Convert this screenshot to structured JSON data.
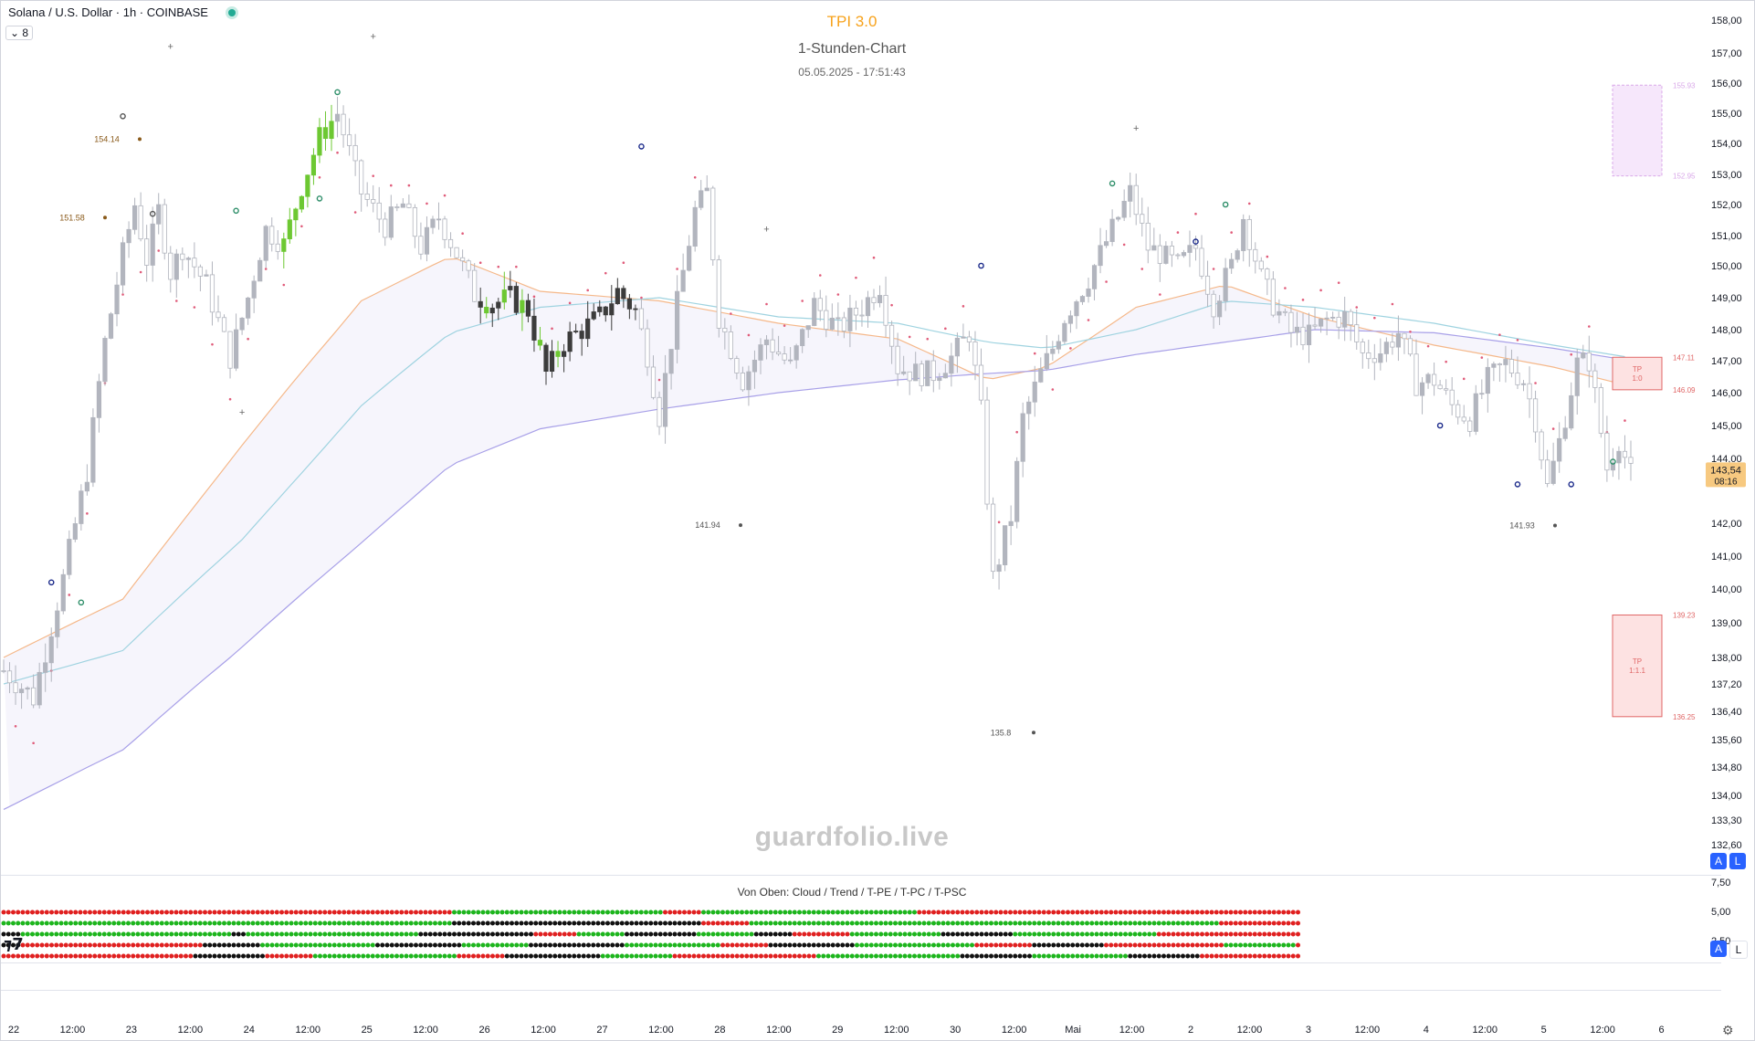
{
  "header": {
    "symbol": "Solana / U.S. Dollar · 1h · COINBASE",
    "collapse_count": "8",
    "title": "TPI 3.0",
    "subtitle": "1-Stunden-Chart",
    "timestamp": "05.05.2025 - 17:51:43"
  },
  "watermark": "guardfolio.live",
  "indicator_label": "Von Oben: Cloud / Trend / T-PE / T-PC / T-PSC",
  "colors": {
    "up": "#6dc832",
    "down_dark": "#3c3c3c",
    "neutral": "#b2b5be",
    "red_dot": "#e02020",
    "green_dot": "#1db51d",
    "black_dot": "#111111",
    "trend_dots": "#e05c7a",
    "ema_orange": "#f5b88a",
    "ema_teal": "#9fd3e0",
    "ema_purple": "#a8a0e8",
    "tp_red": "#e06666",
    "tp_pink": "#d9a8e8",
    "price_badge": "#f7c980"
  },
  "axis_badges": {
    "a": "A",
    "l": "L"
  },
  "icons": [
    "tradingview-logo-icon",
    "settings-gear-icon",
    "chevron-down-icon",
    "live-status-icon"
  ],
  "chart_data": [
    {
      "type": "candlestick",
      "title": "TPI 3.0",
      "subtitle": "1-Stunden-Chart",
      "ylim": [
        132.6,
        158.0
      ],
      "y_ticks": [
        "158,00",
        "157,00",
        "156,00",
        "155,00",
        "154,00",
        "153,00",
        "152,00",
        "151,00",
        "150,00",
        "149,00",
        "148,00",
        "147,00",
        "146,00",
        "145,00",
        "144,00",
        "142,00",
        "141,00",
        "140,00",
        "139,00",
        "138,00",
        "137,20",
        "136,40",
        "135,60",
        "134,80",
        "134,00",
        "133,30",
        "132,60"
      ],
      "y_tick_values": [
        158,
        157,
        156,
        155,
        154,
        153,
        152,
        151,
        150,
        149,
        148,
        147,
        146,
        145,
        144,
        142,
        141,
        140,
        139,
        138,
        137.2,
        136.4,
        135.6,
        134.8,
        134,
        133.3,
        132.6
      ],
      "x_ticks": [
        "22",
        "12:00",
        "23",
        "12:00",
        "24",
        "12:00",
        "25",
        "12:00",
        "26",
        "12:00",
        "27",
        "12:00",
        "28",
        "12:00",
        "29",
        "12:00",
        "30",
        "12:00",
        "Mai",
        "12:00",
        "2",
        "12:00",
        "3",
        "12:00",
        "4",
        "12:00",
        "5",
        "12:00",
        "6"
      ],
      "last_price": "143,54",
      "countdown": "08:16",
      "level_labels": [
        {
          "text": "154.14",
          "value": 154.14
        },
        {
          "text": "151.58",
          "value": 151.58
        },
        {
          "text": "141.94",
          "value": 141.94
        },
        {
          "text": "141.93",
          "value": 141.93
        },
        {
          "text": "135.8",
          "value": 135.8
        }
      ],
      "targets": [
        {
          "label": "TP",
          "sublabel": "1:0",
          "top": 147.11,
          "bottom": 146.09,
          "top_text": "147.11",
          "bottom_text": "146.09",
          "color": "red"
        },
        {
          "label": "TP",
          "sublabel": "1:1.1",
          "top": 139.23,
          "bottom": 136.25,
          "top_text": "139.23",
          "bottom_text": "136.25",
          "color": "red"
        },
        {
          "label": "",
          "sublabel": "",
          "top": 155.93,
          "bottom": 152.95,
          "top_text": "155.93",
          "bottom_text": "152.95",
          "color": "pink"
        }
      ],
      "price_path": [
        [
          0,
          137.6
        ],
        [
          5,
          136.8
        ],
        [
          10,
          140.3
        ],
        [
          14,
          143.6
        ],
        [
          17,
          147.6
        ],
        [
          20,
          150.4
        ],
        [
          22,
          152.0
        ],
        [
          24,
          150.2
        ],
        [
          26,
          151.8
        ],
        [
          28,
          149.8
        ],
        [
          30,
          150.6
        ],
        [
          34,
          149.4
        ],
        [
          38,
          147.1
        ],
        [
          41,
          149.0
        ],
        [
          44,
          151.2
        ],
        [
          47,
          150.7
        ],
        [
          50,
          152.6
        ],
        [
          53,
          154.2
        ],
        [
          56,
          155.0
        ],
        [
          60,
          152.4
        ],
        [
          64,
          151.3
        ],
        [
          67,
          152.0
        ],
        [
          70,
          150.6
        ],
        [
          73,
          151.6
        ],
        [
          76,
          150.4
        ],
        [
          79,
          149.1
        ],
        [
          82,
          148.8
        ],
        [
          85,
          149.0
        ],
        [
          88,
          148.6
        ],
        [
          91,
          146.6
        ],
        [
          94,
          147.6
        ],
        [
          97,
          148.0
        ],
        [
          100,
          148.4
        ],
        [
          103,
          149.2
        ],
        [
          106,
          148.6
        ],
        [
          108,
          147.2
        ],
        [
          110,
          145.3
        ],
        [
          113,
          148.8
        ],
        [
          116,
          151.8
        ],
        [
          118,
          152.4
        ],
        [
          120,
          148.4
        ],
        [
          124,
          146.4
        ],
        [
          128,
          147.7
        ],
        [
          132,
          146.8
        ],
        [
          136,
          148.8
        ],
        [
          140,
          148.0
        ],
        [
          144,
          148.7
        ],
        [
          147,
          149.4
        ],
        [
          150,
          146.8
        ],
        [
          153,
          146.6
        ],
        [
          156,
          146.6
        ],
        [
          159,
          147.1
        ],
        [
          162,
          147.9
        ],
        [
          164,
          145.4
        ],
        [
          166,
          140.3
        ],
        [
          169,
          142.2
        ],
        [
          171,
          145.2
        ],
        [
          174,
          146.6
        ],
        [
          176,
          147.4
        ],
        [
          178,
          148.4
        ],
        [
          182,
          149.6
        ],
        [
          186,
          151.2
        ],
        [
          189,
          152.4
        ],
        [
          192,
          150.6
        ],
        [
          194,
          150.4
        ],
        [
          197,
          150.0
        ],
        [
          200,
          150.6
        ],
        [
          203,
          148.8
        ],
        [
          206,
          150.0
        ],
        [
          208,
          151.6
        ],
        [
          211,
          149.6
        ],
        [
          213,
          148.8
        ],
        [
          216,
          147.9
        ],
        [
          219,
          147.8
        ],
        [
          222,
          148.3
        ],
        [
          225,
          148.4
        ],
        [
          228,
          147.2
        ],
        [
          231,
          147.3
        ],
        [
          234,
          147.9
        ],
        [
          237,
          146.3
        ],
        [
          240,
          146.4
        ],
        [
          243,
          145.6
        ],
        [
          246,
          145.2
        ],
        [
          249,
          146.4
        ],
        [
          252,
          146.9
        ],
        [
          255,
          146.4
        ],
        [
          257,
          145.2
        ],
        [
          259,
          143.1
        ],
        [
          261,
          144.5
        ],
        [
          264,
          146.9
        ],
        [
          266,
          147.0
        ],
        [
          269,
          143.7
        ],
        [
          271,
          144.6
        ],
        [
          273,
          143.5
        ]
      ],
      "series": [
        {
          "name": "",
          "color": "orange",
          "points": [
            [
              0,
              138.0
            ],
            [
              20,
              139.7
            ],
            [
              40,
              144.4
            ],
            [
              60,
              148.9
            ],
            [
              75,
              150.3
            ],
            [
              90,
              149.2
            ],
            [
              110,
              148.9
            ],
            [
              130,
              148.2
            ],
            [
              150,
              147.7
            ],
            [
              165,
              146.4
            ],
            [
              175,
              146.8
            ],
            [
              190,
              148.7
            ],
            [
              205,
              149.4
            ],
            [
              220,
              148.4
            ],
            [
              240,
              147.5
            ],
            [
              260,
              146.8
            ],
            [
              273,
              146.2
            ]
          ]
        },
        {
          "name": "",
          "color": "teal",
          "points": [
            [
              0,
              137.2
            ],
            [
              20,
              138.2
            ],
            [
              40,
              141.5
            ],
            [
              60,
              145.6
            ],
            [
              75,
              147.9
            ],
            [
              90,
              148.7
            ],
            [
              110,
              149.0
            ],
            [
              130,
              148.4
            ],
            [
              150,
              148.2
            ],
            [
              165,
              147.6
            ],
            [
              175,
              147.4
            ],
            [
              190,
              148.0
            ],
            [
              205,
              148.9
            ],
            [
              220,
              148.7
            ],
            [
              240,
              148.2
            ],
            [
              260,
              147.5
            ],
            [
              273,
              147.1
            ]
          ]
        },
        {
          "name": "",
          "color": "purple",
          "points": [
            [
              0,
              133.6
            ],
            [
              20,
              135.3
            ],
            [
              40,
              138.3
            ],
            [
              60,
              141.4
            ],
            [
              75,
              143.8
            ],
            [
              90,
              144.9
            ],
            [
              110,
              145.5
            ],
            [
              130,
              146.0
            ],
            [
              150,
              146.4
            ],
            [
              165,
              146.6
            ],
            [
              175,
              146.7
            ],
            [
              190,
              147.2
            ],
            [
              205,
              147.6
            ],
            [
              220,
              148.0
            ],
            [
              240,
              147.9
            ],
            [
              260,
              147.4
            ],
            [
              273,
              147.0
            ]
          ]
        }
      ]
    },
    {
      "type": "dot-matrix",
      "title": "Von Oben: Cloud / Trend / T-PE / T-PC / T-PSC",
      "y_ticks": [
        "7,50",
        "5,00",
        "2,50"
      ],
      "rows": [
        {
          "name": "Cloud",
          "segments": [
            [
              "red",
              94
            ],
            [
              "green",
              44
            ],
            [
              "red",
              8
            ],
            [
              "green",
              45
            ],
            [
              "red",
              80
            ]
          ]
        },
        {
          "name": "Trend",
          "segments": [
            [
              "green",
              94
            ],
            [
              "black",
              52
            ],
            [
              "red",
              10
            ],
            [
              "green",
              98
            ],
            [
              "red",
              17
            ]
          ]
        },
        {
          "name": "T-PE",
          "segments": [
            [
              "black",
              4
            ],
            [
              "green",
              44
            ],
            [
              "black",
              3
            ],
            [
              "green",
              36
            ],
            [
              "black",
              24
            ],
            [
              "red",
              9
            ],
            [
              "green",
              10
            ],
            [
              "black",
              15
            ],
            [
              "green",
              12
            ],
            [
              "black",
              8
            ],
            [
              "red",
              12
            ],
            [
              "green",
              19
            ],
            [
              "black",
              15
            ],
            [
              "green",
              30
            ],
            [
              "red",
              30
            ]
          ]
        },
        {
          "name": "T-PC",
          "segments": [
            [
              "black",
              4
            ],
            [
              "red",
              38
            ],
            [
              "black",
              12
            ],
            [
              "green",
              24
            ],
            [
              "black",
              18
            ],
            [
              "green",
              14
            ],
            [
              "black",
              20
            ],
            [
              "green",
              20
            ],
            [
              "red",
              10
            ],
            [
              "black",
              18
            ],
            [
              "green",
              25
            ],
            [
              "red",
              12
            ],
            [
              "black",
              15
            ],
            [
              "red",
              25
            ],
            [
              "green",
              15
            ]
          ]
        },
        {
          "name": "T-PSC",
          "segments": [
            [
              "red",
              40
            ],
            [
              "black",
              15
            ],
            [
              "red",
              10
            ],
            [
              "green",
              30
            ],
            [
              "red",
              10
            ],
            [
              "black",
              20
            ],
            [
              "green",
              15
            ],
            [
              "red",
              30
            ],
            [
              "green",
              30
            ],
            [
              "black",
              15
            ],
            [
              "green",
              20
            ],
            [
              "black",
              15
            ],
            [
              "red",
              22
            ]
          ]
        }
      ]
    }
  ]
}
